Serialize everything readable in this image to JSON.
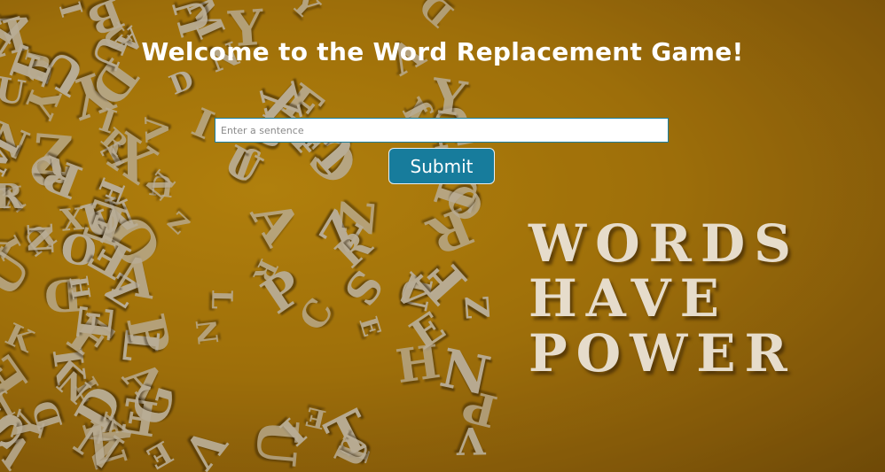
{
  "page": {
    "title": "Welcome to the Word Replacement Game!"
  },
  "form": {
    "sentence_value": "",
    "sentence_placeholder": "Enter a sentence",
    "submit_label": "Submit"
  },
  "background": {
    "phrase_lines": [
      "WORDS",
      "HAVE",
      "POWER"
    ],
    "scattered_letters": "ZOUESLCTKPHVNGDAXYBRFQWIMJ"
  },
  "colors": {
    "background_accent": "#c98f0f",
    "button": "#177c9c",
    "input_border": "#1a7fa0",
    "title_text": "#ffffff"
  }
}
